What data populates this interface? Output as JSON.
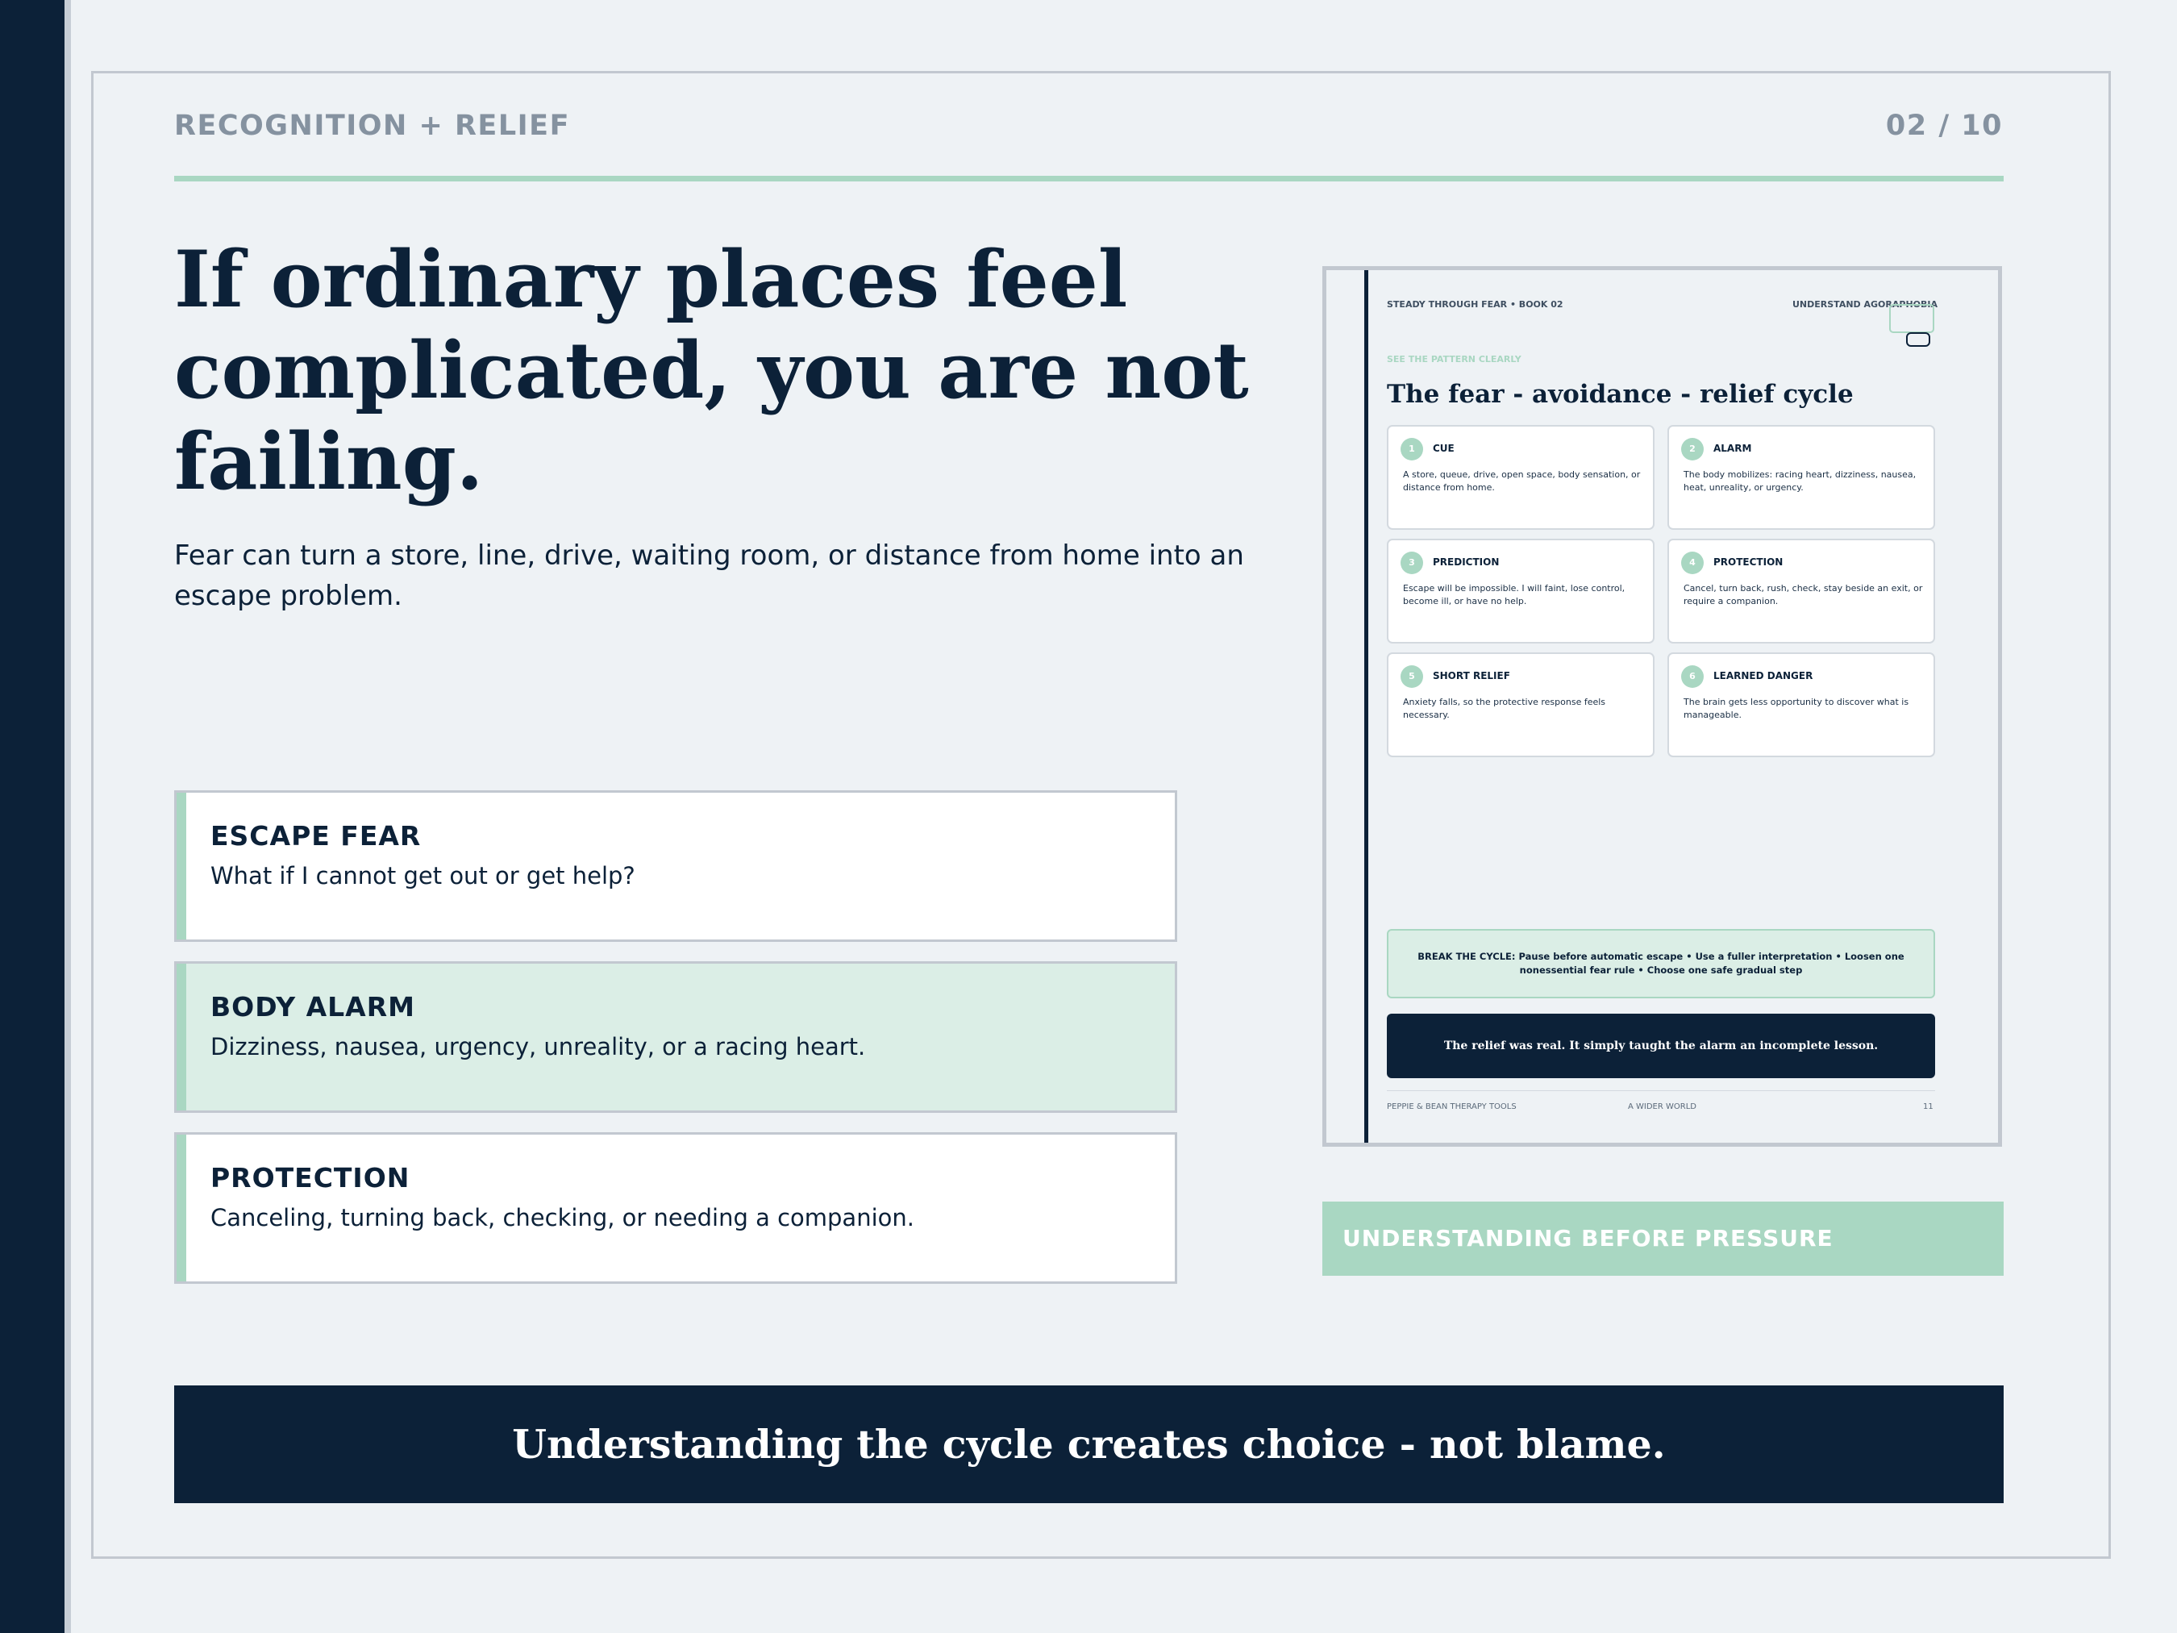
{
  "slide": {
    "kicker": "RECOGNITION + RELIEF",
    "page_number": "02 / 10",
    "headline": "If ordinary places feel complicated, you are not failing.",
    "lede": "Fear can turn a store, line, drive, waiting room, or distance from home into an escape problem.",
    "cards": [
      {
        "title": "ESCAPE FEAR",
        "text": "What if I cannot get out or get help?"
      },
      {
        "title": "BODY ALARM",
        "text": "Dizziness, nausea, urgency, unreality, or a racing heart."
      },
      {
        "title": "PROTECTION",
        "text": "Canceling, turning back, checking, or needing a companion."
      }
    ],
    "caption": "UNDERSTANDING BEFORE PRESSURE",
    "banner": "Understanding the cycle creates choice - not blame."
  },
  "book_page": {
    "series": "STEADY THROUGH FEAR  •  BOOK 02",
    "unit": "UNDERSTAND AGORAPHOBIA",
    "kicker": "SEE THE PATTERN CLEARLY",
    "title": "The fear - avoidance - relief cycle",
    "steps": [
      {
        "num": "1",
        "title": "CUE",
        "text": "A store, queue, drive, open space, body sensation, or distance from home."
      },
      {
        "num": "2",
        "title": "ALARM",
        "text": "The body mobilizes: racing heart, dizziness, nausea, heat, unreality, or urgency."
      },
      {
        "num": "3",
        "title": "PREDICTION",
        "text": "Escape will be impossible. I will faint, lose control, become ill, or have no help."
      },
      {
        "num": "4",
        "title": "PROTECTION",
        "text": "Cancel, turn back, rush, check, stay beside an exit, or require a companion."
      },
      {
        "num": "5",
        "title": "SHORT RELIEF",
        "text": "Anxiety falls, so the protective response feels necessary."
      },
      {
        "num": "6",
        "title": "LEARNED DANGER",
        "text": "The brain gets less opportunity to discover what is manageable."
      }
    ],
    "break_cycle": "BREAK THE CYCLE: Pause before automatic escape • Use a fuller interpretation • Loosen one nonessential fear rule • Choose one safe gradual step",
    "quote": "The relief was real. It simply taught the alarm an incomplete lesson.",
    "footer_left": "PEPPIE & BEAN THERAPY TOOLS",
    "footer_center": "A WIDER WORLD",
    "footer_right": "11"
  },
  "colors": {
    "navy": "#0c2138",
    "mint": "#a9d7c2",
    "mint_light": "#dbeee6",
    "background": "#eef2f5",
    "muted": "#8592a0"
  }
}
